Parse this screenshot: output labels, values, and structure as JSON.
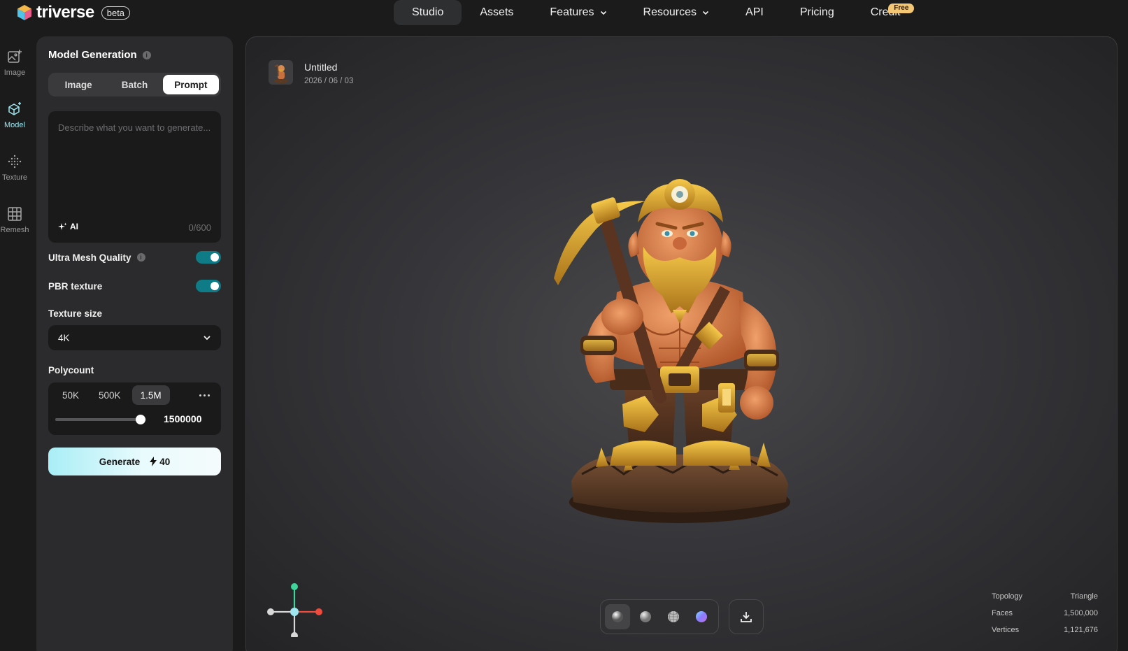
{
  "brand": {
    "name": "triverse",
    "badge": "beta"
  },
  "nav": {
    "items": [
      {
        "label": "Studio",
        "active": true
      },
      {
        "label": "Assets"
      },
      {
        "label": "Features",
        "dropdown": true
      },
      {
        "label": "Resources",
        "dropdown": true
      },
      {
        "label": "API"
      },
      {
        "label": "Pricing"
      },
      {
        "label": "Credit",
        "badge": "Free"
      }
    ]
  },
  "rail": {
    "items": [
      {
        "label": "Image",
        "icon": "image-plus-icon"
      },
      {
        "label": "Model",
        "icon": "cube-sparkle-icon",
        "active": true
      },
      {
        "label": "Texture",
        "icon": "dot-grid-icon"
      },
      {
        "label": "Remesh",
        "icon": "grid-icon"
      }
    ]
  },
  "panel": {
    "title": "Model Generation",
    "tabs": [
      "Image",
      "Batch",
      "Prompt"
    ],
    "active_tab": "Prompt",
    "prompt": {
      "placeholder": "Describe what you want to generate...",
      "value": "",
      "ai_label": "AI",
      "counter": "0/600"
    },
    "ultra_mesh": {
      "label": "Ultra Mesh Quality",
      "on": true
    },
    "pbr": {
      "label": "PBR texture",
      "on": true
    },
    "texture_size": {
      "label": "Texture size",
      "value": "4K"
    },
    "polycount": {
      "label": "Polycount",
      "options": [
        "50K",
        "500K",
        "1.5M"
      ],
      "selected": "1.5M",
      "value": "1500000",
      "slider_fraction": 0.94
    },
    "generate": {
      "label": "Generate",
      "cost": "40"
    }
  },
  "viewer": {
    "asset_name": "Untitled",
    "asset_date": "2026 / 06 / 03",
    "stats": [
      {
        "label": "Topology",
        "value": "Triangle"
      },
      {
        "label": "Faces",
        "value": "1,500,000"
      },
      {
        "label": "Vertices",
        "value": "1,121,676"
      }
    ],
    "materials": [
      "clay",
      "matte",
      "wireframe",
      "normal"
    ],
    "accent": "#0f7b86"
  }
}
